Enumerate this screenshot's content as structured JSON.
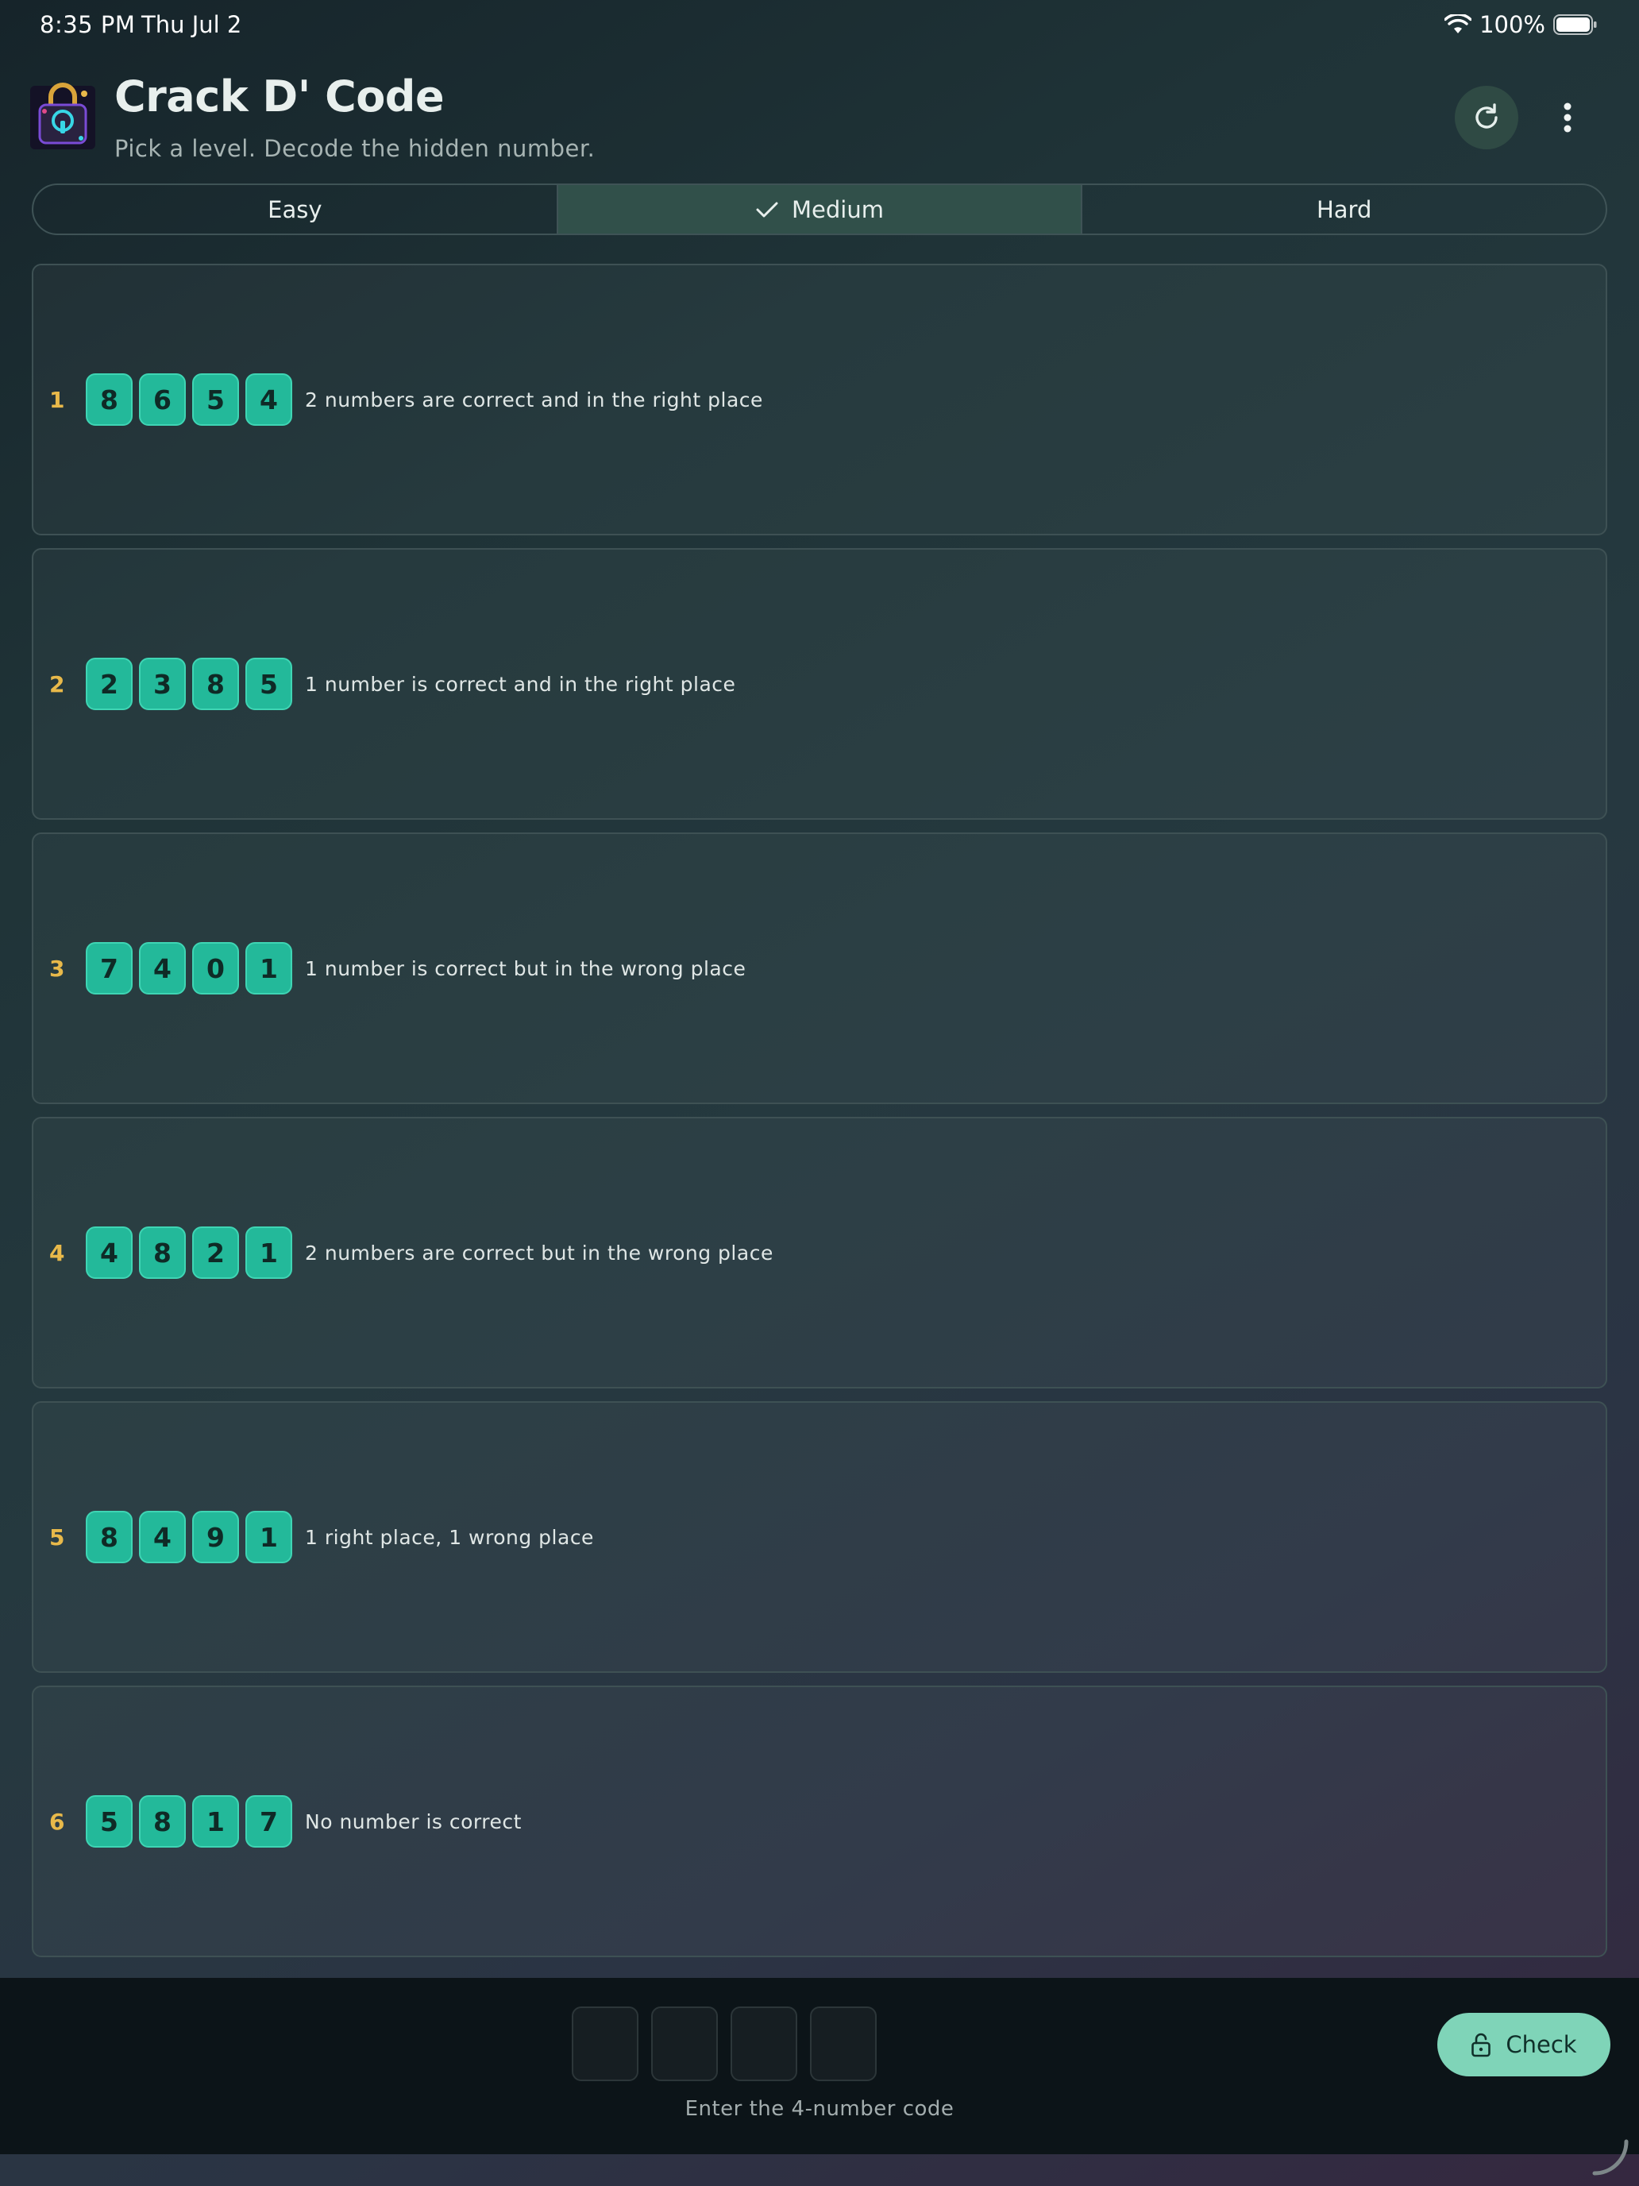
{
  "status_bar": {
    "time": "8:35 PM",
    "date": "Thu Jul 2",
    "battery": "100%"
  },
  "header": {
    "title": "Crack D' Code",
    "subtitle": "Pick a level. Decode the hidden number.",
    "logo_icon": "padlock-logo-icon",
    "refresh_icon": "refresh-icon",
    "more_icon": "more-vertical-icon"
  },
  "levels": {
    "items": [
      {
        "label": "Easy",
        "selected": false
      },
      {
        "label": "Medium",
        "selected": true
      },
      {
        "label": "Hard",
        "selected": false
      }
    ]
  },
  "clues": [
    {
      "number": "1",
      "digits": [
        "8",
        "6",
        "5",
        "4"
      ],
      "text": "2 numbers are correct and in the right place"
    },
    {
      "number": "2",
      "digits": [
        "2",
        "3",
        "8",
        "5"
      ],
      "text": "1 number is correct and in the right place"
    },
    {
      "number": "3",
      "digits": [
        "7",
        "4",
        "0",
        "1"
      ],
      "text": "1 number is correct but in the wrong place"
    },
    {
      "number": "4",
      "digits": [
        "4",
        "8",
        "2",
        "1"
      ],
      "text": "2 numbers are correct but in the wrong place"
    },
    {
      "number": "5",
      "digits": [
        "8",
        "4",
        "9",
        "1"
      ],
      "text": "1 right place, 1 wrong place"
    },
    {
      "number": "6",
      "digits": [
        "5",
        "8",
        "1",
        "7"
      ],
      "text": "No number is correct"
    }
  ],
  "entry": {
    "slots": [
      "",
      "",
      "",
      ""
    ],
    "hint": "Enter the 4-number code",
    "check_label": "Check",
    "check_icon": "lock-icon"
  },
  "colors": {
    "accent_gold": "#e8b94a",
    "digit_tile": "#23b99a",
    "check_button": "#7fd4b8",
    "selected_segment": "#31504a"
  }
}
